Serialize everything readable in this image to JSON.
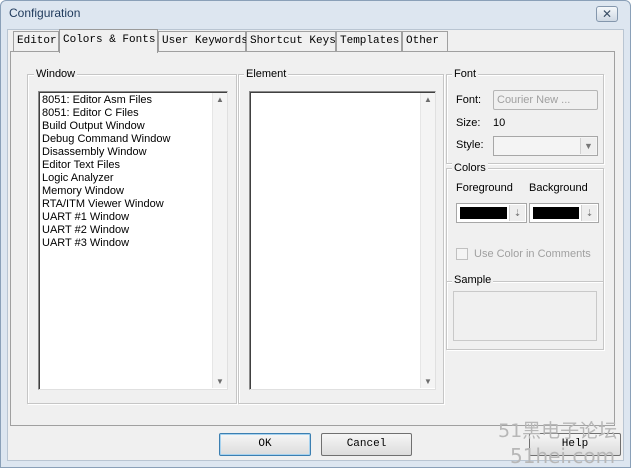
{
  "window": {
    "title": "Configuration"
  },
  "tabs": [
    "Editor",
    "Colors & Fonts",
    "User Keywords",
    "Shortcut Keys",
    "Templates",
    "Other"
  ],
  "window_group": {
    "label": "Window",
    "items": [
      "8051: Editor Asm Files",
      "8051: Editor C Files",
      "Build Output Window",
      "Debug Command Window",
      "Disassembly Window",
      "Editor Text Files",
      "Logic Analyzer",
      "Memory Window",
      "RTA/ITM Viewer Window",
      "UART #1 Window",
      "UART #2 Window",
      "UART #3 Window"
    ]
  },
  "element_group": {
    "label": "Element"
  },
  "font_group": {
    "label": "Font",
    "font_label": "Font:",
    "font_button": "Courier New ...",
    "size_label": "Size:",
    "size_value": "10",
    "style_label": "Style:"
  },
  "colors_group": {
    "label": "Colors",
    "foreground_label": "Foreground",
    "background_label": "Background",
    "foreground_color": "#000000",
    "background_color": "#000000",
    "use_color_label": "Use Color in Comments"
  },
  "sample_group": {
    "label": "Sample"
  },
  "buttons": {
    "ok": "OK",
    "cancel": "Cancel",
    "help": "Help"
  },
  "watermark": {
    "line1": "51黑电子论坛",
    "line2": "51hei.com"
  }
}
